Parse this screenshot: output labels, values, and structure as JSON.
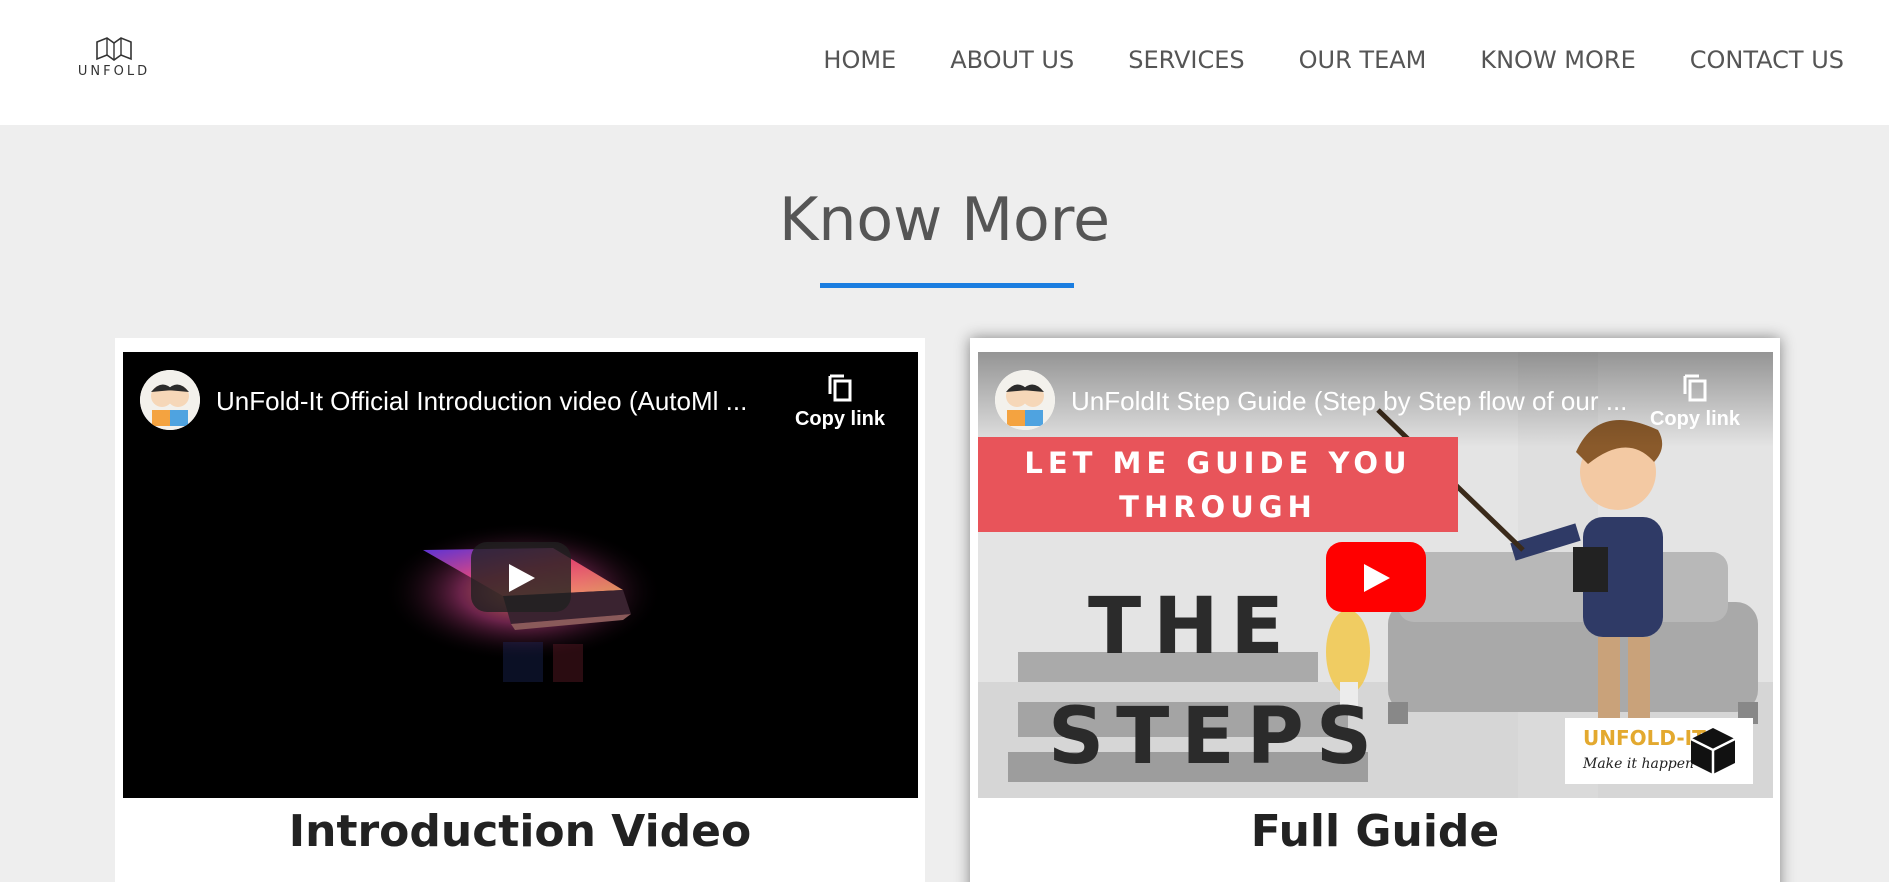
{
  "header": {
    "logo_text": "UNFOLD",
    "nav": [
      "HOME",
      "ABOUT US",
      "SERVICES",
      "OUR TEAM",
      "KNOW MORE",
      "CONTACT US"
    ]
  },
  "section": {
    "title": "Know More",
    "accent_color": "#1a7de0"
  },
  "cards": [
    {
      "video_title": "UnFold-It Official Introduction video (AutoMl ...",
      "copy_link_label": "Copy link",
      "caption": "Introduction Video"
    },
    {
      "video_title": "UnFoldIt Step Guide (Step by Step flow of our ...",
      "copy_link_label": "Copy link",
      "caption": "Full Guide",
      "thumbnail": {
        "banner_line1": "LET ME GUIDE YOU",
        "banner_line2": "THROUGH",
        "big_line1": "THE",
        "big_line2": "STEPS",
        "logo_text": "UNFOLD-IT",
        "logo_tagline": "Make it happen"
      }
    }
  ],
  "icons": [
    "unfold-logo-icon",
    "copy-icon",
    "play-icon",
    "channel-avatar"
  ]
}
